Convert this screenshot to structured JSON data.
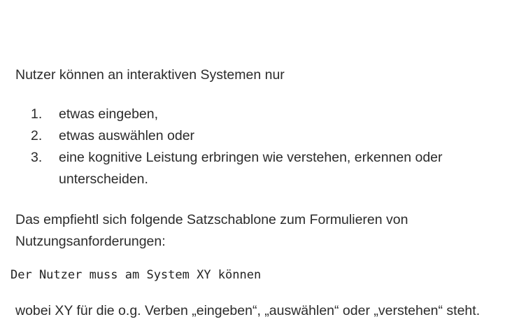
{
  "intro": "Nutzer können an interaktiven Systemen nur",
  "list": [
    {
      "number": "1.",
      "text": "etwas eingeben,"
    },
    {
      "number": "2.",
      "text": "etwas auswählen oder"
    },
    {
      "number": "3.",
      "text": "eine kognitive Leistung erbringen wie verstehen, erkennen oder unterscheiden."
    }
  ],
  "paragraph2": "Das empfiehtl sich folgende Satzschablone zum Formulieren von Nutzungsanforderungen:",
  "code": "Der Nutzer muss am System XY können",
  "paragraph3": "wobei XY für die o.g. Verben „eingeben“, „auswählen“ oder „verstehen“ steht."
}
